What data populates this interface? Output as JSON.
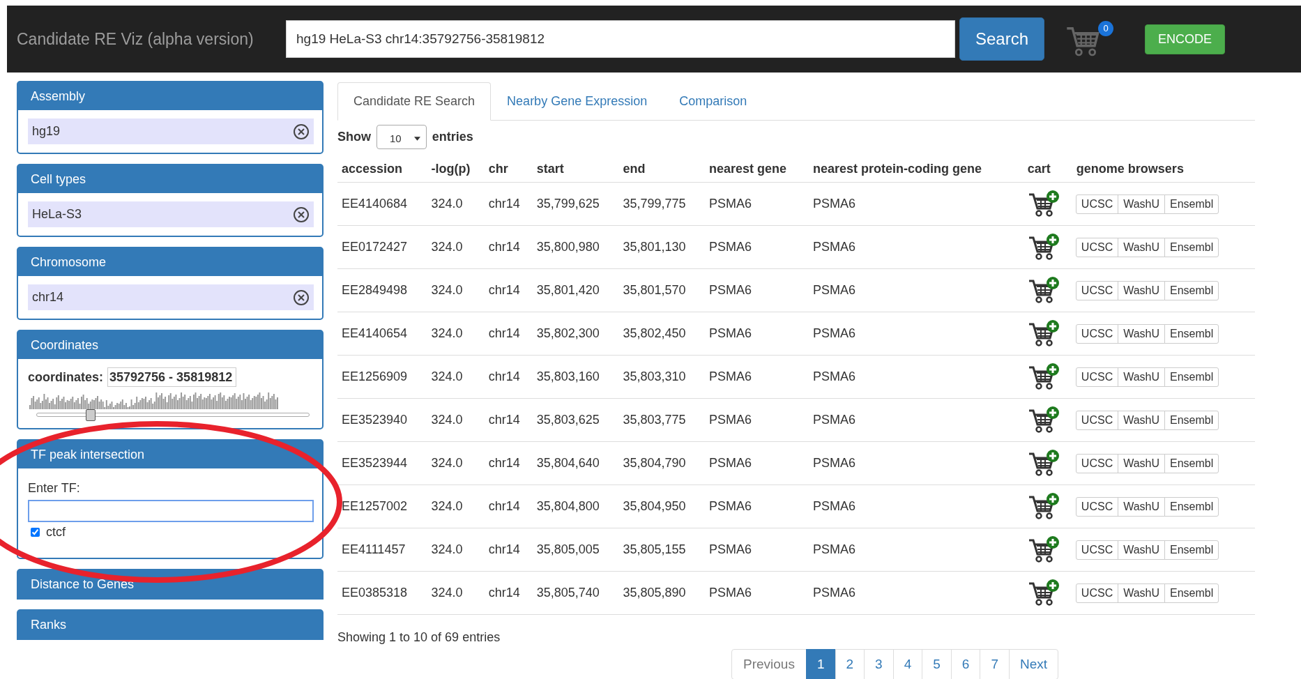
{
  "header": {
    "title": "Candidate RE Viz (alpha version)",
    "search_value": "hg19 HeLa-S3 chr14:35792756-35819812",
    "search_button": "Search",
    "cart_count": "0",
    "encode_button": "ENCODE"
  },
  "sidebar": {
    "panels": [
      {
        "kind": "select",
        "title": "Assembly",
        "value": "hg19"
      },
      {
        "kind": "select",
        "title": "Cell types",
        "value": "HeLa-S3"
      },
      {
        "kind": "select",
        "title": "Chromosome",
        "value": "chr14"
      },
      {
        "kind": "coords",
        "title": "Coordinates",
        "label": "coordinates:",
        "value": "35792756 - 35819812",
        "level": 0.18
      },
      {
        "kind": "tf",
        "title": "TF peak intersection",
        "label": "Enter TF:",
        "options": [
          {
            "label": "ctcf",
            "checked": true
          }
        ]
      },
      {
        "kind": "collapsed",
        "title": "Distance to Genes"
      },
      {
        "kind": "collapsed",
        "title": "Ranks"
      }
    ]
  },
  "tabs": [
    {
      "label": "Candidate RE Search",
      "selected": true
    },
    {
      "label": "Nearby Gene Expression",
      "selected": false
    },
    {
      "label": "Comparison",
      "selected": false
    }
  ],
  "length_menu": {
    "prefix": "Show",
    "value": "10",
    "suffix": "entries"
  },
  "table": {
    "columns": [
      "accession",
      "-log(p)",
      "chr",
      "start",
      "end",
      "nearest gene",
      "nearest protein-coding gene",
      "cart",
      "genome browsers"
    ],
    "rows": [
      {
        "cells": [
          "EE4140684",
          "324.0",
          "chr14",
          "35,799,625",
          "35,799,775",
          "PSMA6",
          "PSMA6"
        ],
        "browsers": [
          "UCSC",
          "WashU",
          "Ensembl"
        ]
      },
      {
        "cells": [
          "EE0172427",
          "324.0",
          "chr14",
          "35,800,980",
          "35,801,130",
          "PSMA6",
          "PSMA6"
        ],
        "browsers": [
          "UCSC",
          "WashU",
          "Ensembl"
        ]
      },
      {
        "cells": [
          "EE2849498",
          "324.0",
          "chr14",
          "35,801,420",
          "35,801,570",
          "PSMA6",
          "PSMA6"
        ],
        "browsers": [
          "UCSC",
          "WashU",
          "Ensembl"
        ]
      },
      {
        "cells": [
          "EE4140654",
          "324.0",
          "chr14",
          "35,802,300",
          "35,802,450",
          "PSMA6",
          "PSMA6"
        ],
        "browsers": [
          "UCSC",
          "WashU",
          "Ensembl"
        ]
      },
      {
        "cells": [
          "EE1256909",
          "324.0",
          "chr14",
          "35,803,160",
          "35,803,310",
          "PSMA6",
          "PSMA6"
        ],
        "browsers": [
          "UCSC",
          "WashU",
          "Ensembl"
        ]
      },
      {
        "cells": [
          "EE3523940",
          "324.0",
          "chr14",
          "35,803,625",
          "35,803,775",
          "PSMA6",
          "PSMA6"
        ],
        "browsers": [
          "UCSC",
          "WashU",
          "Ensembl"
        ]
      },
      {
        "cells": [
          "EE3523944",
          "324.0",
          "chr14",
          "35,804,640",
          "35,804,790",
          "PSMA6",
          "PSMA6"
        ],
        "browsers": [
          "UCSC",
          "WashU",
          "Ensembl"
        ]
      },
      {
        "cells": [
          "EE1257002",
          "324.0",
          "chr14",
          "35,804,800",
          "35,804,950",
          "PSMA6",
          "PSMA6"
        ],
        "browsers": [
          "UCSC",
          "WashU",
          "Ensembl"
        ]
      },
      {
        "cells": [
          "EE4111457",
          "324.0",
          "chr14",
          "35,805,005",
          "35,805,155",
          "PSMA6",
          "PSMA6"
        ],
        "browsers": [
          "UCSC",
          "WashU",
          "Ensembl"
        ]
      },
      {
        "cells": [
          "EE0385318",
          "324.0",
          "chr14",
          "35,805,740",
          "35,805,890",
          "PSMA6",
          "PSMA6"
        ],
        "browsers": [
          "UCSC",
          "WashU",
          "Ensembl"
        ]
      }
    ]
  },
  "info": "Showing 1 to 10 of 69 entries",
  "pagination": {
    "previous": "Previous",
    "next": "Next",
    "pages": [
      {
        "label": "1",
        "selected": true
      },
      {
        "label": "2",
        "selected": false
      },
      {
        "label": "3",
        "selected": false
      },
      {
        "label": "4",
        "selected": false
      },
      {
        "label": "5",
        "selected": false
      },
      {
        "label": "6",
        "selected": false
      },
      {
        "label": "7",
        "selected": false
      }
    ]
  }
}
